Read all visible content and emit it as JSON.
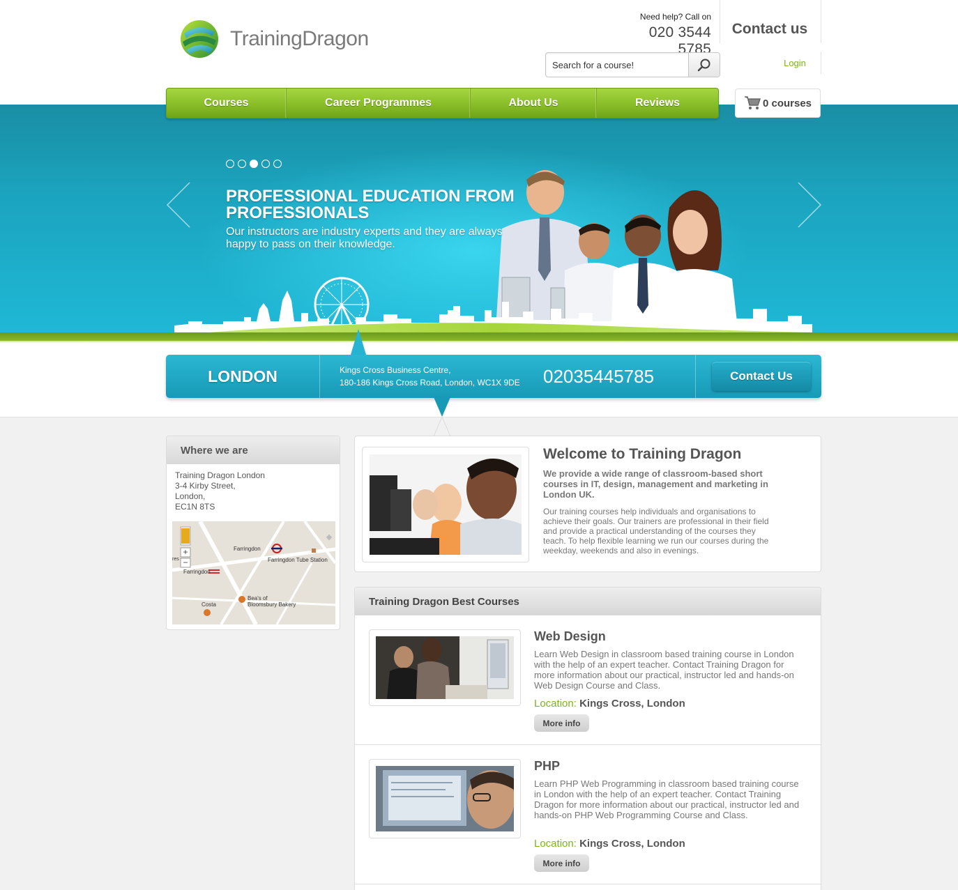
{
  "brand": {
    "name": "TrainingDragon"
  },
  "header": {
    "help_label": "Need help? Call on",
    "phone": "020 3544 5785",
    "contact_label": "Contact us",
    "login_label": "Login",
    "search_placeholder": "Search for a course!"
  },
  "nav": {
    "items": [
      {
        "label": "Courses"
      },
      {
        "label": "Career Programmes"
      },
      {
        "label": "About Us"
      },
      {
        "label": "Reviews"
      }
    ],
    "cart_label": "0 courses"
  },
  "slider": {
    "dots_total": 5,
    "active_dot": 3,
    "title": "PROFESSIONAL EDUCATION FROM PROFESSIONALS",
    "text": "Our instructors are industry experts and they are always happy to pass on their knowledge."
  },
  "location": {
    "city": "LONDON",
    "address_line1": "Kings Cross Business Centre,",
    "address_line2": "180-186 Kings Cross Road, London, WC1X 9DE",
    "phone": "02035445785",
    "contact_button": "Contact Us"
  },
  "sidebar": {
    "title": "Where we are",
    "address": [
      "Training Dragon London",
      "3-4 Kirby Street,",
      "London,",
      "EC1N 8TS"
    ],
    "map_labels": {
      "farringdon_top": "Farringdon",
      "tube_station": "Farringdon Tube Station",
      "farringdon_rail": "Farringdon",
      "costa": "Costa",
      "beas_1": "Bea's of",
      "beas_2": "Bloomsbury Bakery",
      "edge": "res"
    }
  },
  "welcome": {
    "title": "Welcome to Training Dragon",
    "lead": "We provide a wide range of classroom-based short courses in IT, design, management and marketing in London UK.",
    "body": "Our training courses help individuals and organisations to achieve their goals. Our trainers are professional in their field and provide a practical understanding of the courses they teach. To help flexible learning we run our courses during the weekday, weekends and also in evenings."
  },
  "best_courses": {
    "title": "Training Dragon Best Courses",
    "courses": [
      {
        "title": "Web Design",
        "description": "Learn Web Design in classroom based training course in London with the help of an expert teacher. Contact Training Dragon for more information about our practical, instructor led and hands-on Web Design Course and Class.",
        "location_label": "Location:",
        "location": "Kings Cross, London",
        "button": "More info"
      },
      {
        "title": "PHP",
        "description": "Learn PHP Web Programming in classroom based training course in London with the help of an expert teacher. Contact Training Dragon for more information about our practical, instructor led and hands-on PHP Web Programming Course and Class.",
        "location_label": "Location:",
        "location": "Kings Cross, London",
        "button": "More info"
      }
    ]
  },
  "colors": {
    "accent_green": "#7cb518",
    "hero_blue": "#1fb8d6",
    "text_gray": "#555555"
  }
}
